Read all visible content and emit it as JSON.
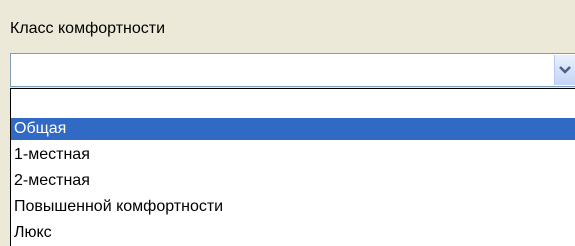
{
  "field": {
    "label": "Класс комфортности",
    "value": ""
  },
  "dropdown": {
    "options": [
      "",
      "Общая",
      "1-местная",
      "2-местная",
      "Повышенной комфортности",
      "Люкс"
    ],
    "selected_index": 1
  },
  "icons": {
    "dropdown_arrow": "chevron-down-icon"
  },
  "colors": {
    "selection": "#316ac5",
    "background": "#ece9d8"
  }
}
